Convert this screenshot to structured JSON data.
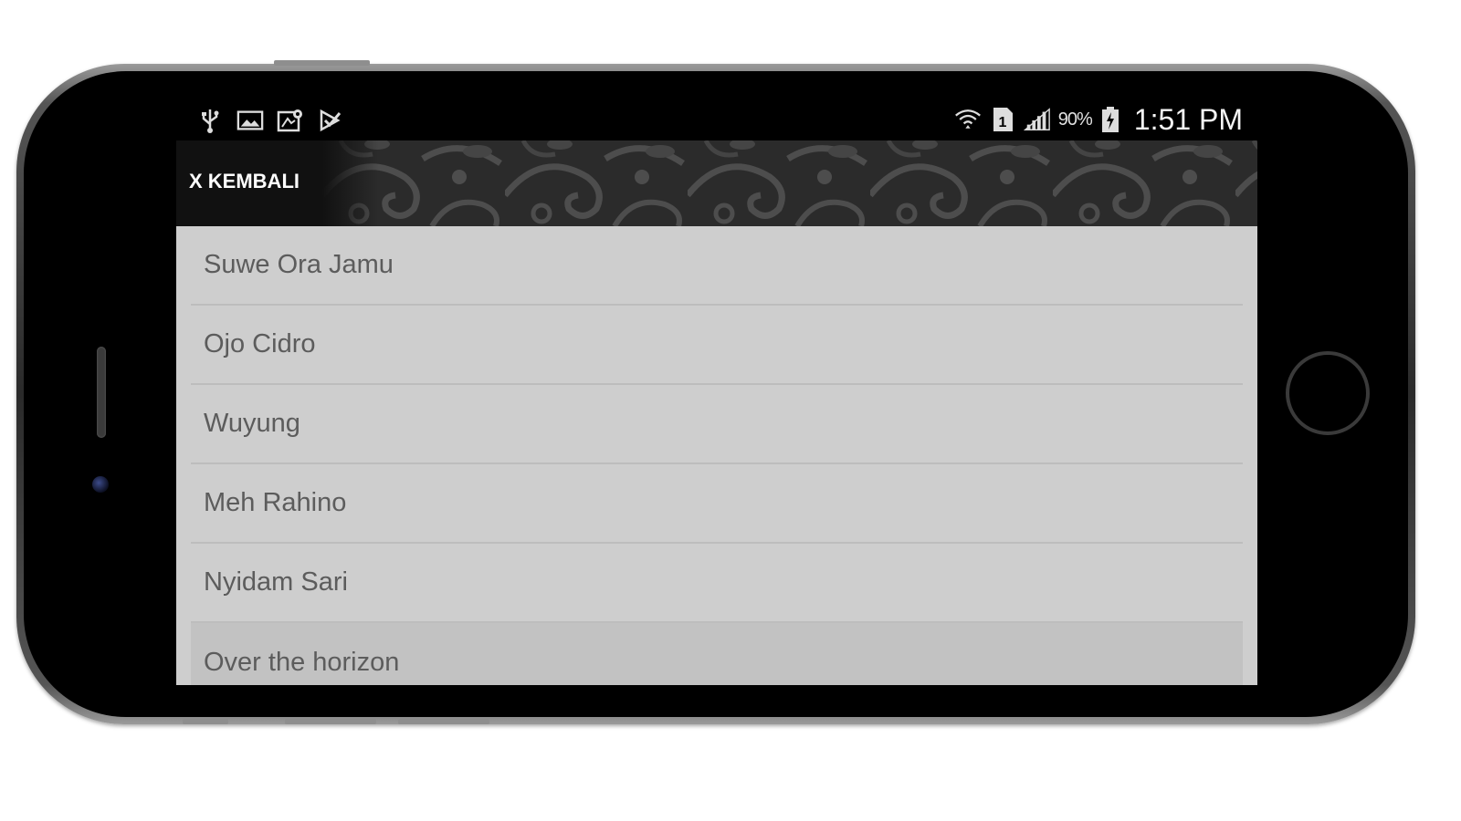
{
  "status_bar": {
    "left_icons": [
      "usb-icon",
      "image-icon",
      "map-icon",
      "play-store-icon"
    ],
    "right_icons": [
      "wifi-icon",
      "sim-icon",
      "signal-icon",
      "battery-icon"
    ],
    "battery_percent": "90%",
    "time": "1:51 PM"
  },
  "action_bar": {
    "back_label": "X KEMBALI"
  },
  "list": {
    "items": [
      {
        "label": "Suwe Ora Jamu"
      },
      {
        "label": "Ojo Cidro"
      },
      {
        "label": "Wuyung"
      },
      {
        "label": "Meh Rahino"
      },
      {
        "label": "Nyidam Sari"
      },
      {
        "label": "Over the horizon"
      }
    ]
  },
  "colors": {
    "list_background": "#cecece",
    "list_text": "#5c5c5c",
    "action_bar": "#111111",
    "ornament": "#4a4a4a"
  }
}
